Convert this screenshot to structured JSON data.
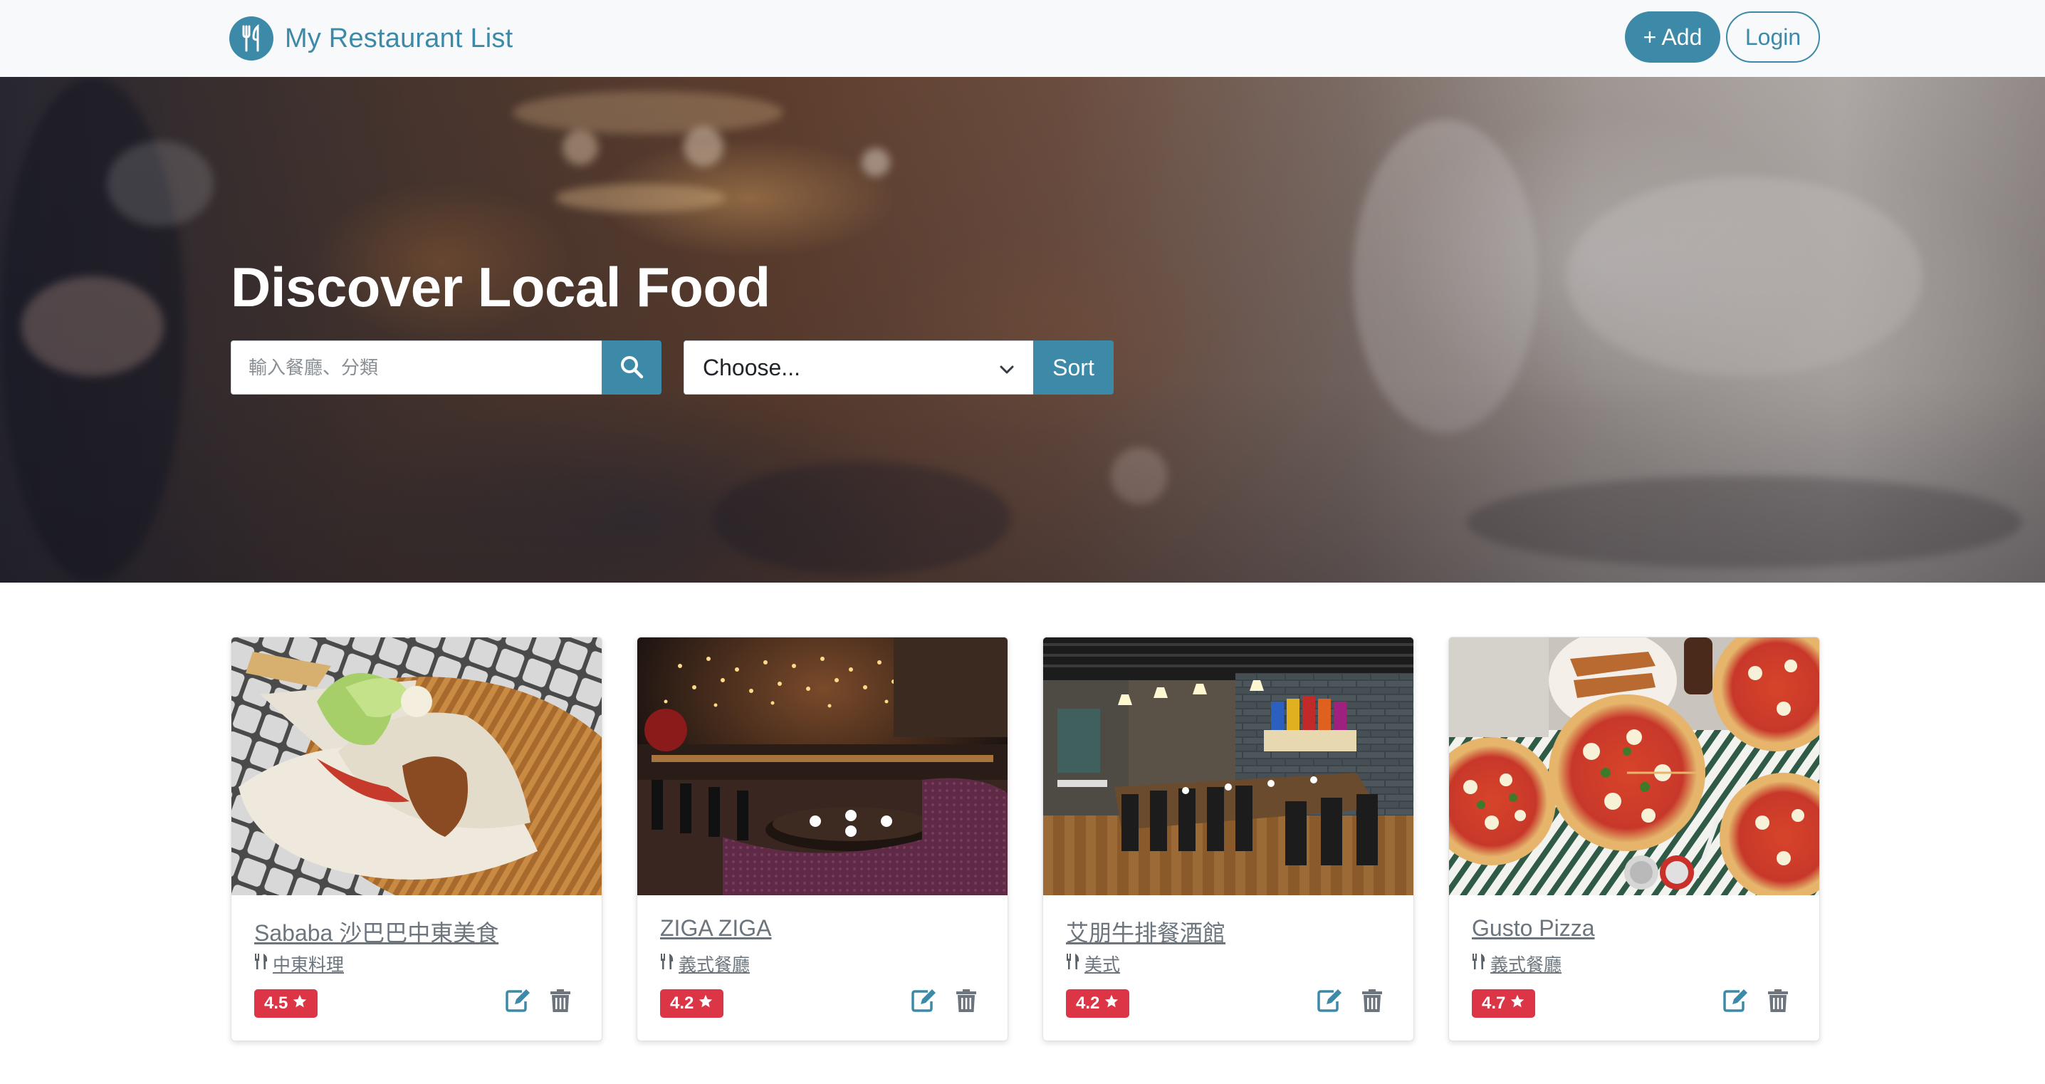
{
  "navbar": {
    "brand": "My Restaurant List",
    "brand_icon": "utensils-icon",
    "add_label": "+ Add",
    "login_label": "Login"
  },
  "hero": {
    "title": "Discover Local Food",
    "search_placeholder": "輸入餐廳、分類",
    "search_icon": "search-icon",
    "sort_select_value": "Choose...",
    "sort_label": "Sort"
  },
  "restaurants": [
    {
      "name": "Sababa 沙巴巴中東美食",
      "category": "中東料理",
      "rating": "4.5"
    },
    {
      "name": "ZIGA ZIGA",
      "category": "義式餐廳",
      "rating": "4.2"
    },
    {
      "name": "艾朋牛排餐酒館",
      "category": "美式",
      "rating": "4.2"
    },
    {
      "name": "Gusto Pizza",
      "category": "義式餐廳",
      "rating": "4.7"
    }
  ],
  "colors": {
    "primary": "#3d8aa8",
    "rating_badge": "#dc3545",
    "navbar_bg": "#f8f9fa"
  }
}
